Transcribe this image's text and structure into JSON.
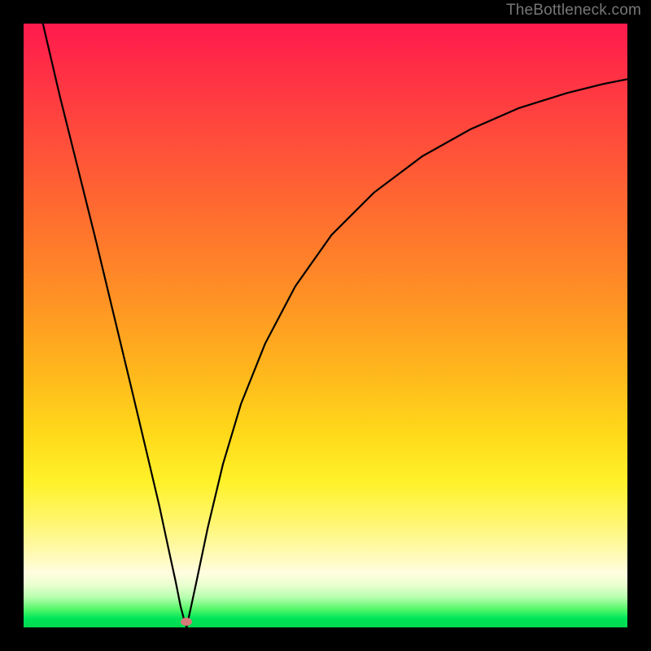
{
  "watermark": "TheBottleneck.com",
  "chart_data": {
    "type": "line",
    "title": "",
    "xlabel": "",
    "ylabel": "",
    "xlim": [
      0,
      1
    ],
    "ylim": [
      0,
      1
    ],
    "series": [
      {
        "name": "left-branch",
        "x": [
          0.032,
          0.06,
          0.09,
          0.12,
          0.15,
          0.18,
          0.205,
          0.225,
          0.24,
          0.252,
          0.26,
          0.266,
          0.27
        ],
        "y": [
          1.0,
          0.88,
          0.76,
          0.64,
          0.515,
          0.39,
          0.285,
          0.2,
          0.13,
          0.075,
          0.035,
          0.012,
          0.0
        ]
      },
      {
        "name": "right-branch",
        "x": [
          0.27,
          0.285,
          0.305,
          0.33,
          0.36,
          0.4,
          0.45,
          0.51,
          0.58,
          0.66,
          0.74,
          0.82,
          0.9,
          0.96,
          1.0
        ],
        "y": [
          0.0,
          0.07,
          0.165,
          0.27,
          0.37,
          0.47,
          0.565,
          0.65,
          0.72,
          0.78,
          0.825,
          0.86,
          0.885,
          0.9,
          0.908
        ]
      }
    ],
    "annotations": [
      {
        "name": "minimum-marker",
        "x": 0.27,
        "y": 0.01
      }
    ],
    "background_gradient": {
      "top": "#ff1a4d",
      "mid_upper": "#ff9324",
      "mid": "#fff22a",
      "lower": "#fffde0",
      "bottom": "#00d94f"
    }
  }
}
